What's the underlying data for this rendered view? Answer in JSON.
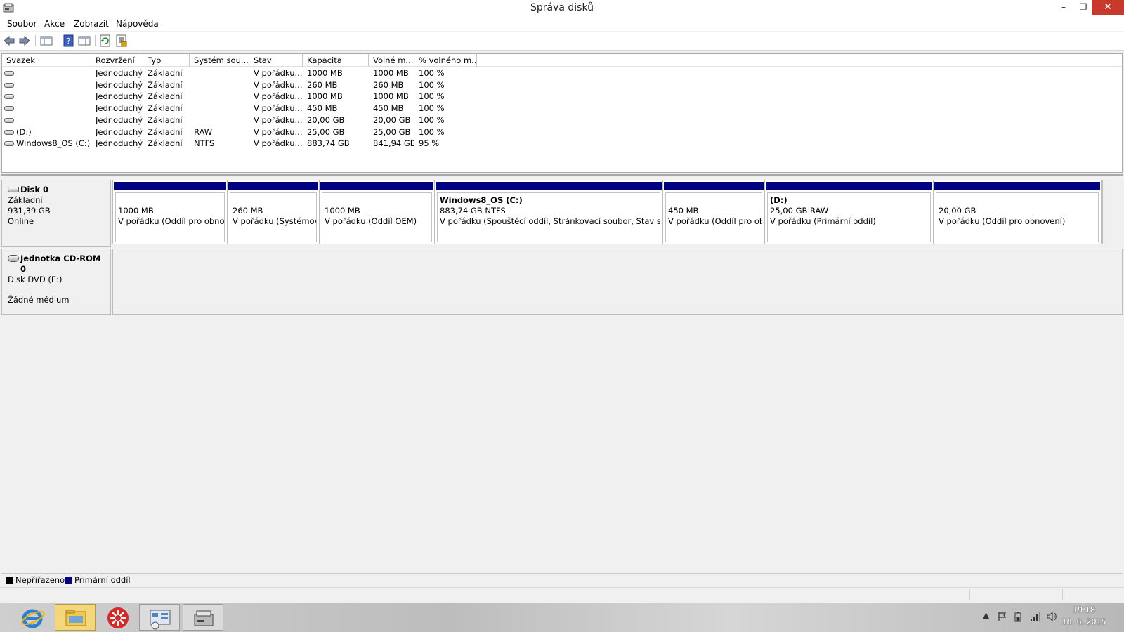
{
  "window": {
    "title": "Správa disků",
    "min_glyph": "–",
    "max_glyph": "❐",
    "close_glyph": "✕"
  },
  "menu": [
    "Soubor",
    "Akce",
    "Zobrazit",
    "Nápověda"
  ],
  "toolbar": {
    "icons": [
      "back-icon",
      "forward-icon",
      "show-hide-console-tree-icon",
      "help-icon",
      "show-hide-action-pane-icon",
      "refresh-icon",
      "properties-icon"
    ]
  },
  "volume_list": {
    "columns": [
      "Svazek",
      "Rozvržení",
      "Typ",
      "Systém sou...",
      "Stav",
      "Kapacita",
      "Volné m...",
      "% volného m..."
    ],
    "rows": [
      {
        "volume": "",
        "layout": "Jednoduchý",
        "type": "Základní",
        "fs": "",
        "status": "V pořádku...",
        "capacity": "1000 MB",
        "free": "1000 MB",
        "pct": "100 %"
      },
      {
        "volume": "",
        "layout": "Jednoduchý",
        "type": "Základní",
        "fs": "",
        "status": "V pořádku...",
        "capacity": "260 MB",
        "free": "260 MB",
        "pct": "100 %"
      },
      {
        "volume": "",
        "layout": "Jednoduchý",
        "type": "Základní",
        "fs": "",
        "status": "V pořádku...",
        "capacity": "1000 MB",
        "free": "1000 MB",
        "pct": "100 %"
      },
      {
        "volume": "",
        "layout": "Jednoduchý",
        "type": "Základní",
        "fs": "",
        "status": "V pořádku...",
        "capacity": "450 MB",
        "free": "450 MB",
        "pct": "100 %"
      },
      {
        "volume": "",
        "layout": "Jednoduchý",
        "type": "Základní",
        "fs": "",
        "status": "V pořádku...",
        "capacity": "20,00 GB",
        "free": "20,00 GB",
        "pct": "100 %"
      },
      {
        "volume": "(D:)",
        "layout": "Jednoduchý",
        "type": "Základní",
        "fs": "RAW",
        "status": "V pořádku...",
        "capacity": "25,00 GB",
        "free": "25,00 GB",
        "pct": "100 %"
      },
      {
        "volume": "Windows8_OS (C:)",
        "layout": "Jednoduchý",
        "type": "Základní",
        "fs": "NTFS",
        "status": "V pořádku...",
        "capacity": "883,74 GB",
        "free": "841,94 GB",
        "pct": "95 %"
      }
    ]
  },
  "disk0": {
    "name": "Disk 0",
    "type": "Základní",
    "size": "931,39 GB",
    "status": "Online",
    "partitions": [
      {
        "title": "",
        "size": "1000 MB",
        "status": "V pořádku (Oddíl pro obnove"
      },
      {
        "title": "",
        "size": "260 MB",
        "status": "V pořádku (Systémový"
      },
      {
        "title": "",
        "size": "1000 MB",
        "status": "V pořádku (Oddíl OEM)"
      },
      {
        "title": "Windows8_OS  (C:)",
        "size": "883,74 GB NTFS",
        "status": "V pořádku (Spouštěcí oddíl, Stránkovací soubor, Stav systém"
      },
      {
        "title": "",
        "size": "450 MB",
        "status": "V pořádku (Oddíl pro obr"
      },
      {
        "title": "(D:)",
        "size": "25,00 GB RAW",
        "status": "V pořádku (Primární oddíl)"
      },
      {
        "title": "",
        "size": "20,00 GB",
        "status": "V pořádku (Oddíl pro obnovení)"
      }
    ]
  },
  "cdrom0": {
    "name": "Jednotka CD-ROM 0",
    "type": "Disk DVD (E:)",
    "media": "Žádné médium"
  },
  "legend": [
    {
      "label": "Nepřiřazeno",
      "color": "#000000"
    },
    {
      "label": "Primární oddíl",
      "color": "#000080"
    }
  ],
  "taskbar": {
    "apps": [
      "internet-explorer-icon",
      "file-explorer-icon",
      "app-red-icon",
      "control-panel-icon",
      "disk-management-icon"
    ],
    "clock_time": "19:18",
    "clock_date": "18. 6. 2015"
  }
}
